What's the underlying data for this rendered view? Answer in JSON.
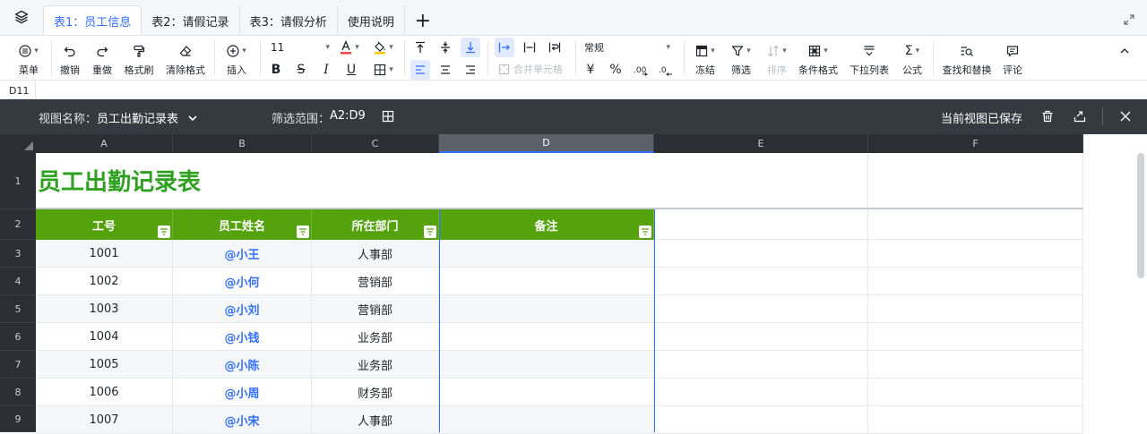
{
  "tabs": [
    {
      "label": "表1：员工信息",
      "active": true
    },
    {
      "label": "表2：请假记录",
      "active": false
    },
    {
      "label": "表3：请假分析",
      "active": false
    },
    {
      "label": "使用说明",
      "active": false
    }
  ],
  "tab_add": "+",
  "toolbar": {
    "menu": "菜单",
    "undo": "撤销",
    "redo": "重做",
    "format_painter": "格式刷",
    "clear_format": "清除格式",
    "insert": "插入",
    "font_size": "11",
    "merge_cells": "合并单元格",
    "number_format": "常规",
    "freeze": "冻结",
    "filter": "筛选",
    "sort": "排序",
    "conditional_format": "条件格式",
    "dropdown_list": "下拉列表",
    "formula": "公式",
    "find_replace": "查找和替换",
    "comment": "评论",
    "bold": "B",
    "strike": "S",
    "italic": "I",
    "underline": "U",
    "currency": "¥",
    "percent": "%"
  },
  "name_box": "D11",
  "viewbar": {
    "view_name_label": "视图名称：",
    "view_name": "员工出勤记录表",
    "filter_range_label": "筛选范围：",
    "filter_range": "A2:D9",
    "saved_status": "当前视图已保存"
  },
  "columns": [
    "A",
    "B",
    "C",
    "D",
    "E",
    "F"
  ],
  "rows": [
    "1",
    "2",
    "3",
    "4",
    "5",
    "6",
    "7",
    "8",
    "9"
  ],
  "sheet": {
    "title": "员工出勤记录表",
    "headers": [
      "工号",
      "员工姓名",
      "所在部门",
      "备注"
    ],
    "records": [
      {
        "id": "1001",
        "name": "@小王",
        "dept": "人事部",
        "note": ""
      },
      {
        "id": "1002",
        "name": "@小何",
        "dept": "营销部",
        "note": ""
      },
      {
        "id": "1003",
        "name": "@小刘",
        "dept": "营销部",
        "note": ""
      },
      {
        "id": "1004",
        "name": "@小钱",
        "dept": "业务部",
        "note": ""
      },
      {
        "id": "1005",
        "name": "@小陈",
        "dept": "业务部",
        "note": ""
      },
      {
        "id": "1006",
        "name": "@小周",
        "dept": "财务部",
        "note": ""
      },
      {
        "id": "1007",
        "name": "@小宋",
        "dept": "人事部",
        "note": ""
      }
    ]
  },
  "colors": {
    "accent": "#3370ff",
    "header_green": "#54a20c",
    "title_green": "#2ea121"
  }
}
